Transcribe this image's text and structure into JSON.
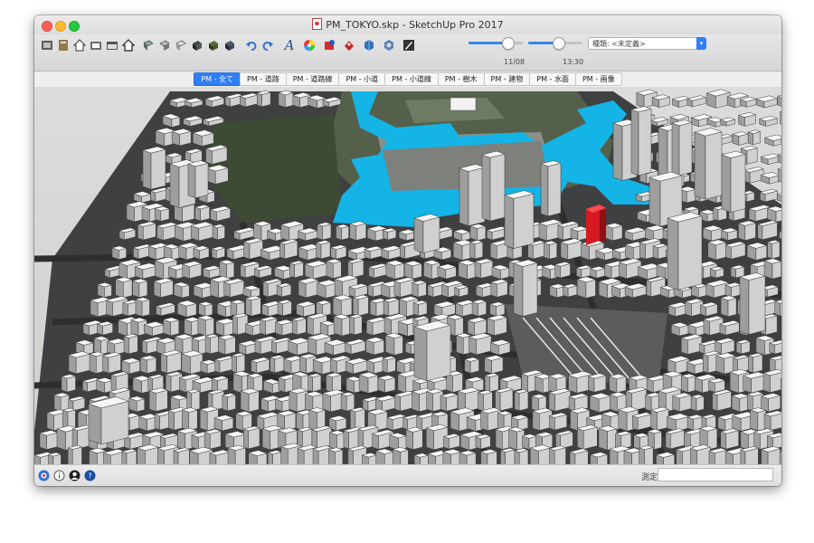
{
  "window": {
    "title": "PM_TOKYO.skp - SketchUp Pro 2017"
  },
  "toolbar": {
    "icons": [
      "get-models-icon",
      "share-model-icon",
      "home-icon",
      "save-icon",
      "open-folder-icon",
      "house-outline-icon",
      "style-front-icon",
      "style-top-icon",
      "style-iso-icon",
      "component-icon",
      "layer-icon",
      "section-icon",
      "undo-icon",
      "redo-icon",
      "text-style-icon",
      "color-wheel-icon",
      "extension-warehouse-icon",
      "layout-icon",
      "style-builder-icon",
      "materials-icon",
      "inspector-icon"
    ],
    "shadow_date": "11/08",
    "shadow_time": "13:30",
    "shadow_date_fraction": 0.72,
    "shadow_time_fraction": 0.55,
    "scene_label": "種類:",
    "scene_placeholder": "<未定義>"
  },
  "tabs": [
    {
      "label": "PM - 全て",
      "active": true
    },
    {
      "label": "PM - 道路",
      "active": false
    },
    {
      "label": "PM - 道路線",
      "active": false
    },
    {
      "label": "PM - 小道",
      "active": false
    },
    {
      "label": "PM - 小道線",
      "active": false
    },
    {
      "label": "PM - 樹木",
      "active": false
    },
    {
      "label": "PM - 建物",
      "active": false
    },
    {
      "label": "PM - 水面",
      "active": false
    },
    {
      "label": "PM - 画像",
      "active": false
    }
  ],
  "statusbar": {
    "icons": [
      "geolocation-icon",
      "info-icon",
      "user-icon",
      "help-icon"
    ],
    "measure_label": "測定",
    "measure_value": ""
  },
  "colors": {
    "accent": "#2f7ef6",
    "water": "#14b4e6",
    "highlight_building": "#d71921",
    "ground": "#d7d8d6",
    "road": "#4b4d4f"
  }
}
